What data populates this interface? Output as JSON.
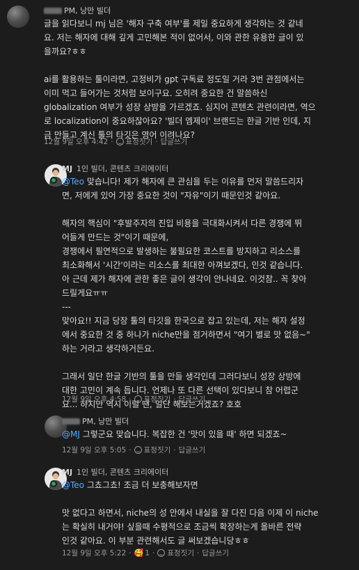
{
  "comments": [
    {
      "author_suffix": "PM, 낭만 빌더",
      "lines": [
        "글을 읽다보니 mj 님은 '해자 구축 여부'를 제일 중요하게 생각하는 것 같네",
        "요. 저는 해자에 대해 깊게 고민해본 적이 없어서, 이와 관한 유용한 글이 있",
        "을까요?ㅎㅎ",
        "",
        "ai를 활용하는 툴이라면, 고정비가 gpt 구독료 정도일 거라 3번 관점에서는",
        "이미 먹고 들어가는 것처럼 보이구요. 오히려 중요한 건 말씀하신",
        "globalization 여부가 성장 상방을 가르겠죠. 심지어 콘텐츠 관련이라면, 역으",
        "로 localization이 중요하잖아요? '빌더 엠제이' 브랜드는 한글 기반 인데, 지",
        "금 만들고 계신 툴의 타깃은 영어 이려나요?"
      ],
      "time": "12월 9일 오후 4:42",
      "react_label": "표정짓기",
      "reply_label": "답글쓰기"
    },
    {
      "author": "MJ",
      "role": "1인 빌더, 콘텐츠 크리에이터",
      "mention": "@Teo",
      "first_line_rest": " 맞습니다! 제가 해자에 큰 관심을 두는 이유를 먼저 말씀드리자",
      "lines": [
        "면, 저에게 있어 가장 중요한 것이 \"자유\"이기 때문인것 같아요.",
        "",
        "해자의 핵심이 \"후발주자의 진입 비용을 극대화시켜서 다른 경쟁에 뛰",
        "어들게 만드는 것\"이기 때문에,",
        "경쟁에서 필연적으로 발생하는 불필요한 코스트를 방지하고 리소스를",
        "최소화해서 '시간'이라는 리소스를 최대한 아껴보겠다, 인것 같습니다.",
        "아 근데 제가 해자에 관한 좋은 글이 생각이 안나네요. 이것참.. 꼭 찾아",
        "드릴게요ㅠㅠ",
        "---",
        "맞아요!! 지금 당장 툴의 타깃을 한국으로 잡고 있는데, 저는 해자 설정",
        "에서 중요한 것 중 하나가 niche만을 점거하면서 \"여기 별로 맛 없음~\"",
        "하는 거라고 생각하거든요.",
        "",
        "그래서 일단 한글 기반의 툴을 만들 생각인데 그러다보니 성장 상방에",
        "대한 고민이 계속 듭니다. 언제나 또 다른 선택이 있다보니 참 어렵군",
        "요... 하지만 역시 이럴 땐, 일단 해보는거겠죠? 호호"
      ],
      "time": "12월 9일 오후 4:58",
      "react_label": "표정짓기",
      "reply_label": "답글쓰기"
    },
    {
      "author_suffix": "PM, 낭만 빌더",
      "mention": "@MJ",
      "first_line_rest": " 그렇군요 맞습니다. 복잡한 건 '맛이 있을 때' 하면 되겠죠~",
      "time": "12월 9일 오후 5:05",
      "react_label": "표정짓기",
      "reply_label": "답글쓰기"
    },
    {
      "author": "MJ",
      "role": "1인 빌더, 콘텐츠 크리에이터",
      "mention": "@Teo",
      "first_line_rest": " 그쵸그쵸! 조금 더 보충해보자면",
      "lines": [
        "",
        "맛 없다고 하면서, niche의 성 안에서 내실을 잘 다진 다음 이제 이 niche",
        "는 확실히 내거야! 싶을때 수평적으로 조금씩 확장하는게 올바른 전략",
        "인것 같아요. 이 부분 관련해서도 글 써보겠습니당ㅎㅎ"
      ],
      "time": "12월 9일 오후 5:22",
      "reaction_emoji": "🥰",
      "reaction_count": "1",
      "react_label": "표정짓기",
      "reply_label": "답글쓰기"
    }
  ]
}
